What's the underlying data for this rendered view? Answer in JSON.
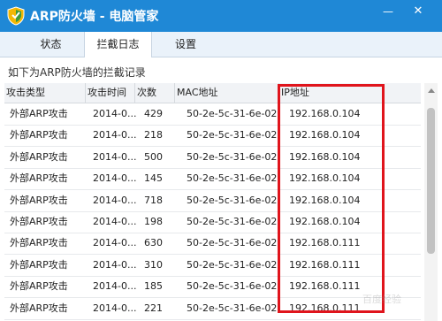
{
  "window": {
    "title": "ARP防火墙 - 电脑管家",
    "minimize_glyph": "—",
    "close_glyph": "✕"
  },
  "tabs": [
    {
      "label": "状态"
    },
    {
      "label": "拦截日志",
      "active": true
    },
    {
      "label": "设置"
    }
  ],
  "description": "如下为ARP防火墙的拦截记录",
  "table": {
    "headers": [
      "攻击类型",
      "攻击时间",
      "次数",
      "MAC地址",
      "IP地址"
    ],
    "rows": [
      [
        "外部ARP攻击",
        "2014-0...",
        "429",
        "50-2e-5c-31-6e-02",
        "192.168.0.104"
      ],
      [
        "外部ARP攻击",
        "2014-0...",
        "218",
        "50-2e-5c-31-6e-02",
        "192.168.0.104"
      ],
      [
        "外部ARP攻击",
        "2014-0...",
        "500",
        "50-2e-5c-31-6e-02",
        "192.168.0.104"
      ],
      [
        "外部ARP攻击",
        "2014-0...",
        "145",
        "50-2e-5c-31-6e-02",
        "192.168.0.104"
      ],
      [
        "外部ARP攻击",
        "2014-0...",
        "718",
        "50-2e-5c-31-6e-02",
        "192.168.0.104"
      ],
      [
        "外部ARP攻击",
        "2014-0...",
        "198",
        "50-2e-5c-31-6e-02",
        "192.168.0.104"
      ],
      [
        "外部ARP攻击",
        "2014-0...",
        "630",
        "50-2e-5c-31-6e-02",
        "192.168.0.111"
      ],
      [
        "外部ARP攻击",
        "2014-0...",
        "310",
        "50-2e-5c-31-6e-02",
        "192.168.0.111"
      ],
      [
        "外部ARP攻击",
        "2014-0...",
        "185",
        "50-2e-5c-31-6e-02",
        "192.168.0.111"
      ],
      [
        "外部ARP攻击",
        "2014-0...",
        "221",
        "50-2e-5c-31-6e-02",
        "192.168.0.111"
      ]
    ]
  },
  "watermark": "百度经验",
  "colors": {
    "titlebar": "#1f88d6",
    "highlight": "#e0141c"
  },
  "icons": {
    "app": "shield-icon"
  }
}
